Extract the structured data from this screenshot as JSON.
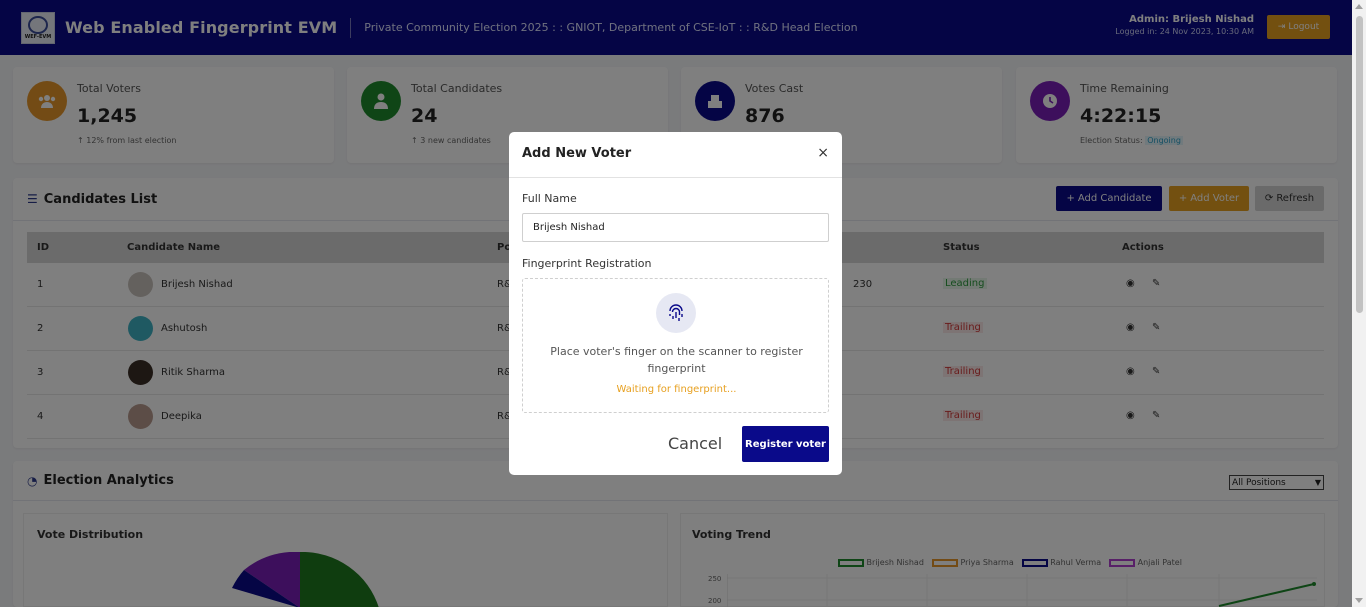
{
  "header": {
    "logo_text": "WEF-EVM",
    "title": "Web Enabled Fingerprint EVM",
    "subtitle": "Private Community Election 2025 : : GNIOT, Department of CSE-IoT : : R&D Head Election",
    "admin_name": "Admin: Brijesh Nishad",
    "logged_in": "Logged in: 24 Nov 2023, 10:30 AM",
    "logout_label": "Logout"
  },
  "stats": [
    {
      "label": "Total Voters",
      "value": "1,245",
      "note": "12% from last election",
      "color": "#e7962a"
    },
    {
      "label": "Total Candidates",
      "value": "24",
      "note": "3 new candidates",
      "color": "#1f8a2c"
    },
    {
      "label": "Votes Cast",
      "value": "876",
      "note": "",
      "color": "#0a0a8a"
    },
    {
      "label": "Time Remaining",
      "value": "4:22:15",
      "note_prefix": "Election Status:",
      "status": "Ongoing",
      "color": "#7a1fb8"
    }
  ],
  "candidates": {
    "title": "Candidates List",
    "add_candidate": "Add Candidate",
    "add_voter": "Add Voter",
    "refresh": "Refresh",
    "columns": [
      "ID",
      "Candidate Name",
      "Po",
      "Status",
      "Actions"
    ],
    "rows": [
      {
        "id": "1",
        "name": "Brijesh Nishad",
        "pos": "R&",
        "votes": "230",
        "status": "Leading"
      },
      {
        "id": "2",
        "name": "Ashutosh",
        "pos": "R&",
        "votes": "",
        "status": "Trailing"
      },
      {
        "id": "3",
        "name": "Ritik Sharma",
        "pos": "R&",
        "votes": "",
        "status": "Trailing"
      },
      {
        "id": "4",
        "name": "Deepika",
        "pos": "R&",
        "votes": "",
        "status": "Trailing"
      }
    ]
  },
  "analytics": {
    "title": "Election Analytics",
    "filter_selected": "All Positions",
    "vote_distribution": "Vote Distribution",
    "voting_trend": "Voting Trend",
    "legend": [
      "Brijesh Nishad",
      "Priya Sharma",
      "Rahul Verma",
      "Anjali Patel"
    ],
    "ticks": [
      "250",
      "200"
    ]
  },
  "modal": {
    "title": "Add New Voter",
    "close": "×",
    "full_name_label": "Full Name",
    "full_name_value": "Brijesh Nishad",
    "fingerprint_label": "Fingerprint Registration",
    "fingerprint_text": "Place voter's finger on the scanner to register fingerprint",
    "waiting": "Waiting for fingerprint...",
    "cancel": "Cancel",
    "register": "Register voter"
  }
}
